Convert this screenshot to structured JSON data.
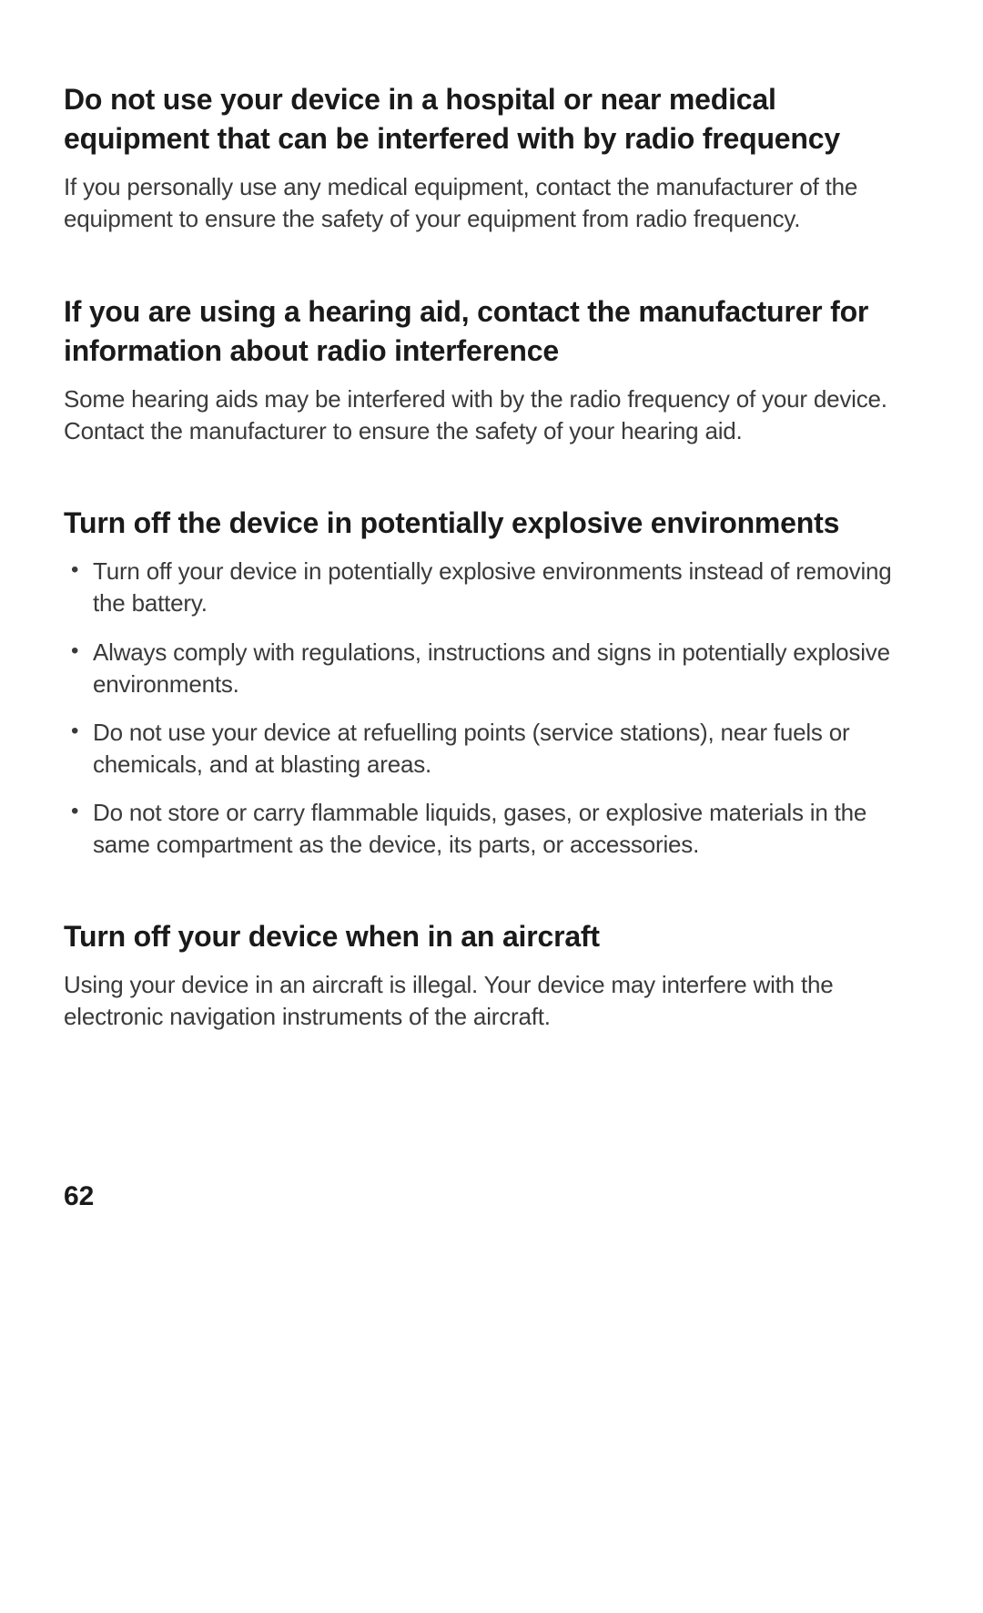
{
  "sections": [
    {
      "heading": "Do not use your device in a hospital or near medical equipment that can be interfered with by radio frequency",
      "body": "If you personally use any medical equipment, contact the manufacturer of the equipment to ensure the safety of your equipment from radio frequency."
    },
    {
      "heading": "If you are using a hearing aid, contact the manufacturer for information about radio interference",
      "body": "Some hearing aids may be interfered with by the radio frequency of your device. Contact the manufacturer to ensure the safety of your hearing aid."
    },
    {
      "heading": "Turn off the device in potentially explosive environments",
      "bullets": [
        "Turn off your device in potentially explosive environments instead of removing the battery.",
        "Always comply with regulations, instructions and signs in potentially explosive environments.",
        "Do not use your device at refuelling points (service stations), near fuels or chemicals, and at blasting areas.",
        "Do not store or carry flammable liquids, gases, or explosive materials in the same compartment as the device, its parts, or accessories."
      ]
    },
    {
      "heading": "Turn off your device when in an aircraft",
      "body": "Using your device in an aircraft is illegal. Your device may interfere with the electronic navigation instruments of the aircraft."
    }
  ],
  "pageNumber": "62"
}
